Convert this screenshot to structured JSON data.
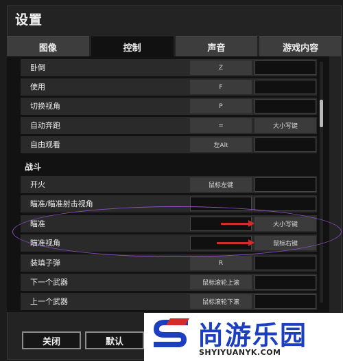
{
  "window": {
    "title": "设置"
  },
  "tabs": [
    {
      "label": "图像",
      "active": false
    },
    {
      "label": "控制",
      "active": true
    },
    {
      "label": "声音",
      "active": false
    },
    {
      "label": "游戏内容",
      "active": false
    }
  ],
  "bindings": {
    "general": [
      {
        "action": "卧倒",
        "primary": "Z",
        "secondary": ""
      },
      {
        "action": "使用",
        "primary": "F",
        "secondary": ""
      },
      {
        "action": "切换视角",
        "primary": "P",
        "secondary": ""
      },
      {
        "action": "自动奔跑",
        "primary": "=",
        "secondary": "大小写键"
      },
      {
        "action": "自由观看",
        "primary": "左Alt",
        "secondary": ""
      }
    ],
    "combat_title": "战斗",
    "combat": [
      {
        "action": "开火",
        "primary": "鼠标左键",
        "secondary": ""
      },
      {
        "action": "瞄准/瞄准射击视角",
        "primary": "",
        "secondary": ""
      },
      {
        "action": "瞄准",
        "primary": "",
        "secondary": "大小写键"
      },
      {
        "action": "瞄准视角",
        "primary": "",
        "secondary": "鼠标右键"
      },
      {
        "action": "装填子弹",
        "primary": "R",
        "secondary": ""
      },
      {
        "action": "下一个武器",
        "primary": "鼠标滚轮上滚",
        "secondary": ""
      },
      {
        "action": "上一个武器",
        "primary": "鼠标滚轮下滚",
        "secondary": ""
      }
    ]
  },
  "footer": {
    "close_label": "关闭",
    "default_label": "默认"
  },
  "watermark": {
    "brand": "尚游乐园",
    "url": "SHYIYUANYK.COM",
    "logo_letter": "S"
  },
  "colors": {
    "accent": "#d42a2a",
    "highlight": "#8a4fc0",
    "watermark_blue": "#1c3fbf"
  }
}
